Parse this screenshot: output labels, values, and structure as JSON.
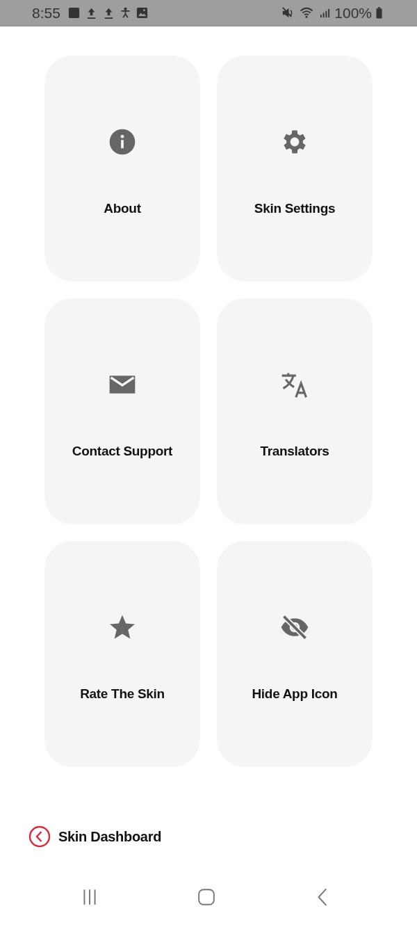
{
  "status_bar": {
    "time": "8:55",
    "battery": "100%"
  },
  "tiles": [
    {
      "kind": "info",
      "label": "About"
    },
    {
      "kind": "gear",
      "label": "Skin Settings"
    },
    {
      "kind": "mail",
      "label": "Contact Support"
    },
    {
      "kind": "translate",
      "label": "Translators"
    },
    {
      "kind": "star",
      "label": "Rate The Skin"
    },
    {
      "kind": "eye-off",
      "label": "Hide App Icon"
    }
  ],
  "back_link": {
    "label": "Skin Dashboard"
  }
}
